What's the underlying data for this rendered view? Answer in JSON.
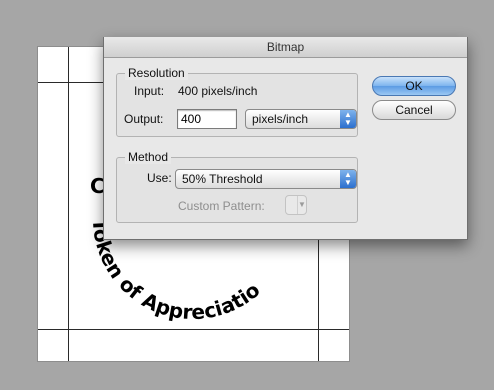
{
  "dialog": {
    "title": "Bitmap"
  },
  "resolution": {
    "group_label": "Resolution",
    "input_label": "Input:",
    "input_value": "400 pixels/inch",
    "output_label": "Output:",
    "output_value": "400",
    "unit_selected": "pixels/inch"
  },
  "method": {
    "group_label": "Method",
    "use_label": "Use:",
    "use_selected": "50% Threshold",
    "custom_pattern_label": "Custom Pattern:"
  },
  "buttons": {
    "ok_label": "OK",
    "cancel_label": "Cancel"
  },
  "document": {
    "arc_text": "Token of Appreciatio",
    "partial_letter": "C"
  },
  "colors": {
    "background": "#a6a6a6",
    "dialog": "#e8e8e8",
    "accent": "#5c9be4"
  },
  "icons": {
    "popup_arrows": "up-down-chevron-icon",
    "pattern_arrow": "chevron-down-icon"
  }
}
